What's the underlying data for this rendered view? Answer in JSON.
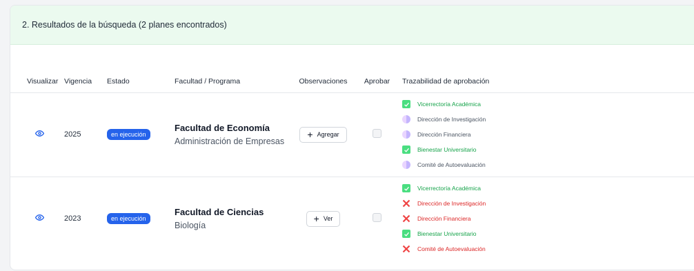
{
  "header": {
    "title": "2. Resultados de la búsqueda (2 planes encontrados)"
  },
  "columns": [
    "Visualizar",
    "Vigencia",
    "Estado",
    "Facultad / Programa",
    "Observaciones",
    "Aprobar",
    "Trazabilidad de aprobación"
  ],
  "colors": {
    "badge": "#2563eb",
    "approved": "#16a34a",
    "rejected": "#dc2626",
    "pending": "#c4b5fd",
    "header_bg": "#ebfaef"
  },
  "rows": [
    {
      "vigencia": "2025",
      "estado": "en ejecución",
      "facultad": "Facultad de Economía",
      "programa": "Administración de Empresas",
      "obs_label": "Agregar",
      "trace": [
        {
          "label": "Vicerrectoría Académica",
          "status": "approved",
          "icon": "check-icon"
        },
        {
          "label": "Dirección de Investigación",
          "status": "pending",
          "icon": "pending-icon"
        },
        {
          "label": "Dirección Financiera",
          "status": "pending",
          "icon": "pending-icon"
        },
        {
          "label": "Bienestar Universitario",
          "status": "approved",
          "icon": "check-icon"
        },
        {
          "label": "Comité de Autoevaluación",
          "status": "pending",
          "icon": "pending-icon"
        }
      ]
    },
    {
      "vigencia": "2023",
      "estado": "en ejecución",
      "facultad": "Facultad de Ciencias",
      "programa": "Biología",
      "obs_label": "Ver",
      "trace": [
        {
          "label": "Vicerrectoría Académica",
          "status": "approved",
          "icon": "check-icon"
        },
        {
          "label": "Dirección de Investigación",
          "status": "rejected",
          "icon": "x-icon"
        },
        {
          "label": "Dirección Financiera",
          "status": "rejected",
          "icon": "x-icon"
        },
        {
          "label": "Bienestar Universitario",
          "status": "approved",
          "icon": "check-icon"
        },
        {
          "label": "Comité de Autoevaluación",
          "status": "rejected",
          "icon": "x-icon"
        }
      ]
    }
  ]
}
